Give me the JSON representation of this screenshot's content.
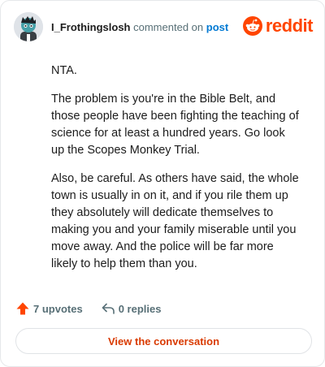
{
  "header": {
    "username": "I_Frothingslosh",
    "action_text": "commented on",
    "post_link": "post",
    "brand": "reddit"
  },
  "comment": {
    "paragraphs": [
      "NTA.",
      "The problem is you're in the Bible Belt, and those people have been fighting the teaching of science for at least a hundred years. Go look up the Scopes Monkey Trial.",
      "Also, be careful. As others have said, the whole town is usually in on it, and if you rile them up they absolutely will dedicate themselves to making you and your family miserable until you move away. And the police will be far more likely to help them than you."
    ]
  },
  "actions": {
    "upvotes": "7 upvotes",
    "replies": "0 replies"
  },
  "cta": {
    "label": "View the conversation"
  },
  "colors": {
    "brand": "#ff4500",
    "link": "#0079d3",
    "cta_text": "#d93a00"
  },
  "icons": {
    "upvote": "upvote-arrow-icon",
    "reply": "reply-arrow-icon",
    "brand": "reddit-snoo-icon"
  }
}
